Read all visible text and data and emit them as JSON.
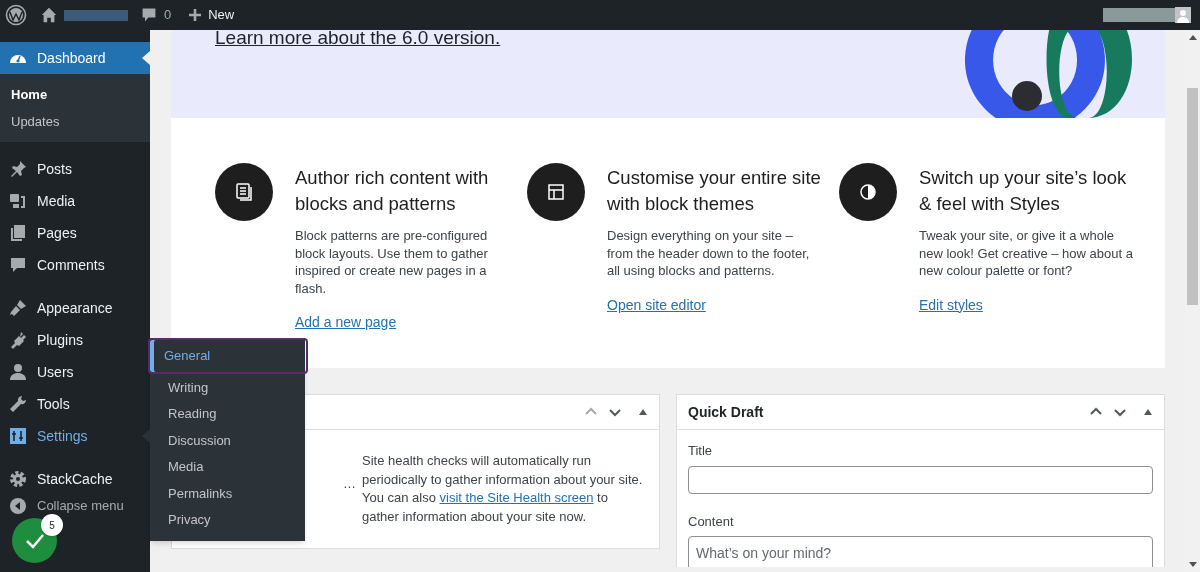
{
  "admin_bar": {
    "comments_count": "0",
    "new_label": "New"
  },
  "sidebar": {
    "items": [
      {
        "label": "Dashboard",
        "kind": "gauge",
        "selected": true,
        "hovered": false,
        "children": [
          {
            "label": "Home",
            "selected": true
          },
          {
            "label": "Updates",
            "selected": false
          }
        ]
      },
      {
        "label": "Posts",
        "kind": "pin",
        "selected": false,
        "hovered": false
      },
      {
        "label": "Media",
        "kind": "media",
        "selected": false,
        "hovered": false
      },
      {
        "label": "Pages",
        "kind": "pages",
        "selected": false,
        "hovered": false
      },
      {
        "label": "Comments",
        "kind": "comment",
        "selected": false,
        "hovered": false
      },
      {
        "label": "Appearance",
        "kind": "brush",
        "selected": false,
        "hovered": false
      },
      {
        "label": "Plugins",
        "kind": "plug",
        "selected": false,
        "hovered": false
      },
      {
        "label": "Users",
        "kind": "user",
        "selected": false,
        "hovered": false
      },
      {
        "label": "Tools",
        "kind": "wrench",
        "selected": false,
        "hovered": false
      },
      {
        "label": "Settings",
        "kind": "sliders",
        "selected": false,
        "hovered": true
      },
      {
        "label": "StackCache",
        "kind": "gear",
        "selected": false,
        "hovered": false
      },
      {
        "label": "Collapse menu",
        "kind": "collapse",
        "selected": false,
        "hovered": false
      }
    ],
    "flyout": [
      {
        "label": "General",
        "selected": true
      },
      {
        "label": "Writing",
        "selected": false
      },
      {
        "label": "Reading",
        "selected": false
      },
      {
        "label": "Discussion",
        "selected": false
      },
      {
        "label": "Media",
        "selected": false
      },
      {
        "label": "Permalinks",
        "selected": false
      },
      {
        "label": "Privacy",
        "selected": false
      }
    ]
  },
  "welcome": {
    "link": "Learn more about the 6.0 version.",
    "columns": [
      {
        "kind": "doc",
        "title": "Author rich content with blocks and patterns",
        "text": "Block patterns are pre-configured block layouts. Use them to gather inspired or create new pages in a flash.",
        "link": "Add a new page"
      },
      {
        "kind": "layout",
        "title": "Customise your entire site with block themes",
        "text": "Design everything on your site – from the header down to the footer, all using blocks and patterns.",
        "link": "Open site editor"
      },
      {
        "kind": "contrast",
        "title": "Switch up your site’s look & feel with Styles",
        "text": "Tweak your site, or give it a whole new look! Get creative – how about a new colour palette or font?",
        "link": "Edit styles"
      }
    ]
  },
  "site_health": {
    "loading": "…",
    "text_before": "Site health checks will automatically run periodically to gather information about your site. You can also ",
    "link": "visit the Site Health screen",
    "text_after": " to gather information about your site now."
  },
  "quick_draft": {
    "title": "Quick Draft",
    "title_label": "Title",
    "content_label": "Content",
    "content_placeholder": "What’s on your mind?"
  },
  "notification_badge": {
    "count": "5"
  }
}
